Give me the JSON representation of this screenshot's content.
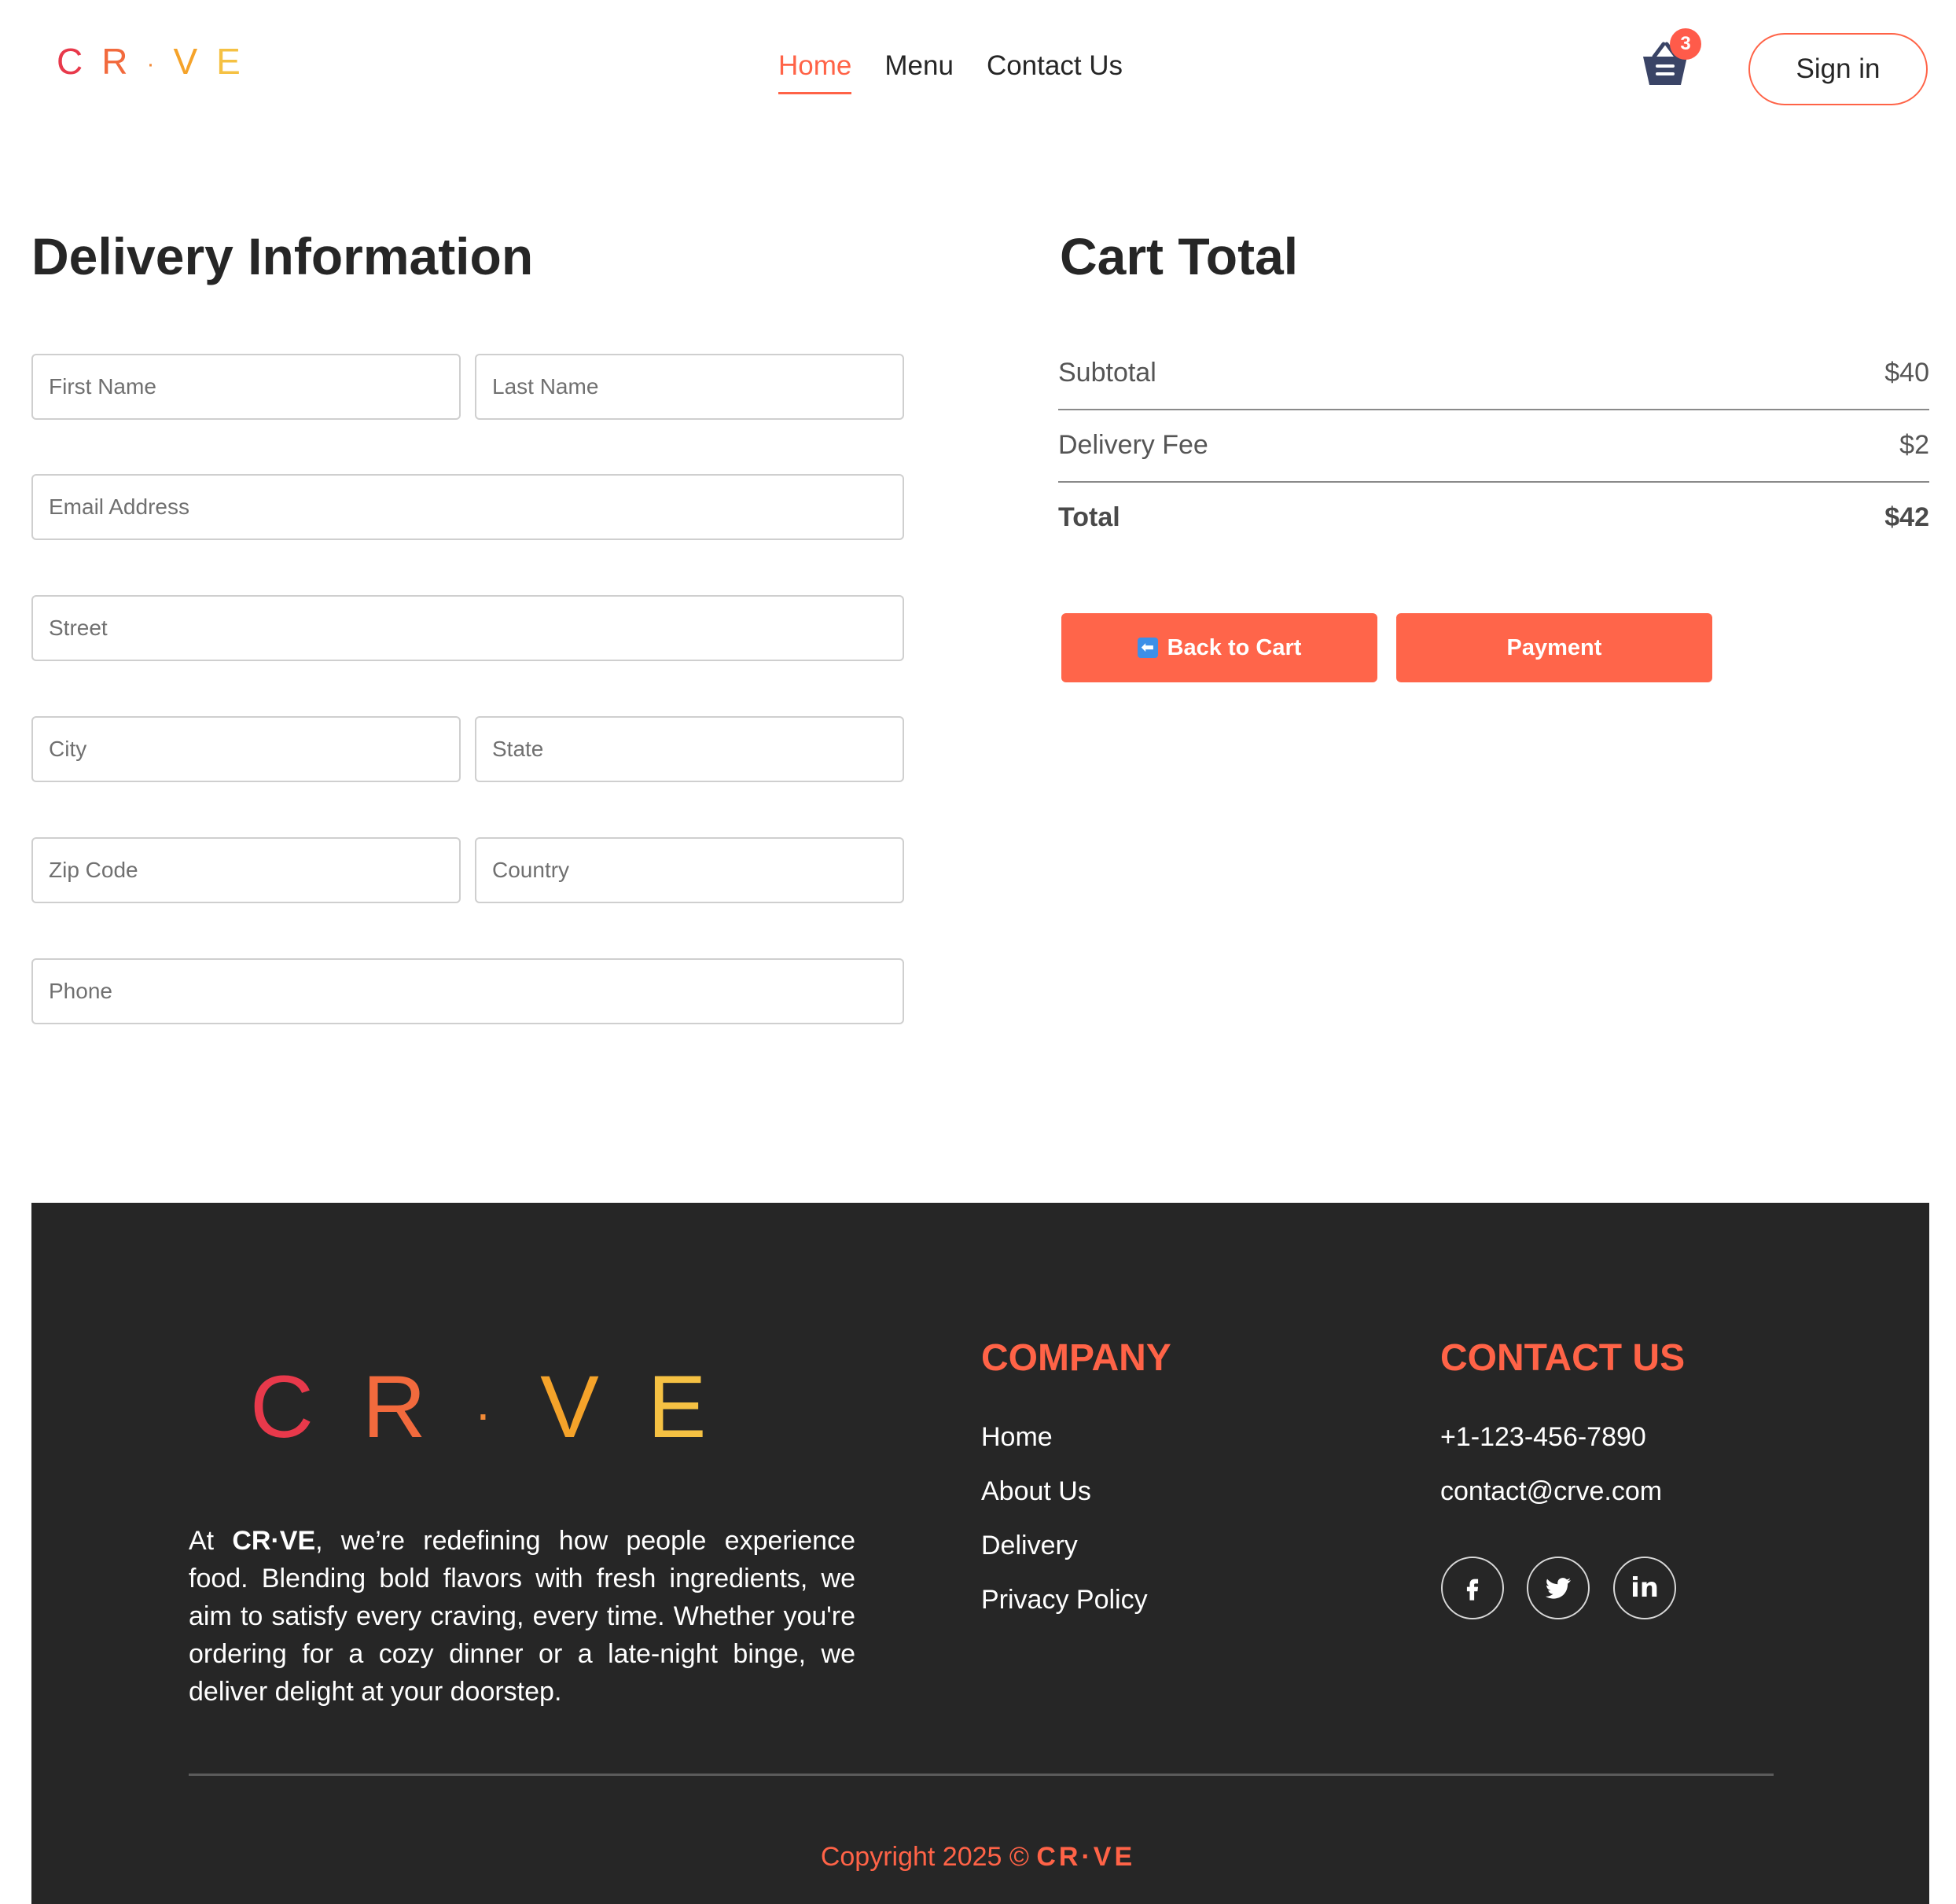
{
  "brand": {
    "letters": [
      "C",
      "R",
      "·",
      "V",
      "E"
    ],
    "letter_colors": [
      "#e8394b",
      "#f26a3d",
      "#f28a36",
      "#f5a32a",
      "#f5c143"
    ],
    "inline_name": "CR·VE"
  },
  "header": {
    "nav": [
      "Home",
      "Menu",
      "Contact Us"
    ],
    "cart_icon": "basket-icon",
    "cart_count": "3",
    "sign_in": "Sign in"
  },
  "delivery": {
    "title": "Delivery Information",
    "placeholders": {
      "first_name": "First Name",
      "last_name": "Last Name",
      "email": "Email Address",
      "street": "Street",
      "city": "City",
      "state": "State",
      "zip": "Zip Code",
      "country": "Country",
      "phone": "Phone"
    }
  },
  "cart_total": {
    "title": "Cart Total",
    "subtotal_label": "Subtotal",
    "subtotal_value": "$40",
    "fee_label": "Delivery Fee",
    "fee_value": "$2",
    "total_label": "Total",
    "total_value": "$42",
    "back_label": "Back to Cart",
    "back_icon": "left-arrow-icon",
    "payment_label": "Payment"
  },
  "footer": {
    "about_prefix": "At",
    "about_text": ", we’re redefining how people experience food. Blending bold flavors with fresh ingredients, we aim to satisfy every craving, every time. Whether you're ordering for a cozy dinner or a late-night binge, we deliver delight at your doorstep.",
    "company_title": "COMPANY",
    "company_links": [
      "Home",
      "About Us",
      "Delivery",
      "Privacy Policy"
    ],
    "contact_title": "CONTACT US",
    "phone": "+1-123-456-7890",
    "email": "contact@crve.com",
    "social": [
      "facebook-icon",
      "twitter-icon",
      "linkedin-icon"
    ],
    "copyright_prefix": "Copyright 2025 ©"
  },
  "colors": {
    "accent": "#ff6347",
    "button": "#ff654a",
    "footer_bg": "#262626"
  }
}
